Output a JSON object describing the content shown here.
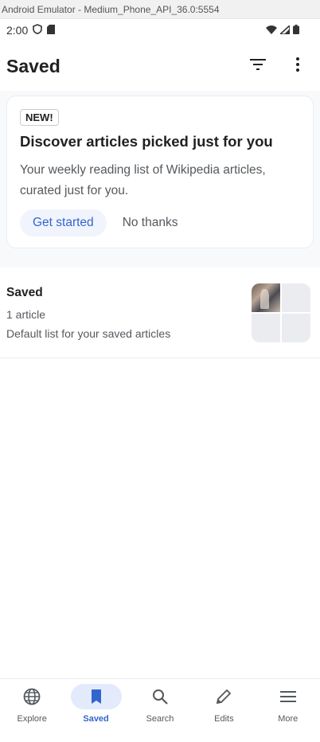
{
  "emulator": {
    "title": "Android Emulator - Medium_Phone_API_36.0:5554"
  },
  "status_bar": {
    "time": "2:00"
  },
  "app_bar": {
    "title": "Saved"
  },
  "promo_card": {
    "badge": "NEW!",
    "title": "Discover articles picked just for you",
    "body": "Your weekly reading list of Wikipedia articles, curated just for you.",
    "primary_button": "Get started",
    "secondary_button": "No thanks"
  },
  "reading_list": {
    "title": "Saved",
    "count": "1 article",
    "description": "Default list for your saved articles"
  },
  "bottom_nav": {
    "items": [
      {
        "label": "Explore",
        "icon": "globe-icon"
      },
      {
        "label": "Saved",
        "icon": "bookmark-icon",
        "active": true
      },
      {
        "label": "Search",
        "icon": "search-icon"
      },
      {
        "label": "Edits",
        "icon": "pencil-icon"
      },
      {
        "label": "More",
        "icon": "menu-icon"
      }
    ]
  },
  "colors": {
    "accent": "#3366cc",
    "active_nav_bg": "#e3eafc",
    "primary_button_bg": "#f1f4fd"
  }
}
